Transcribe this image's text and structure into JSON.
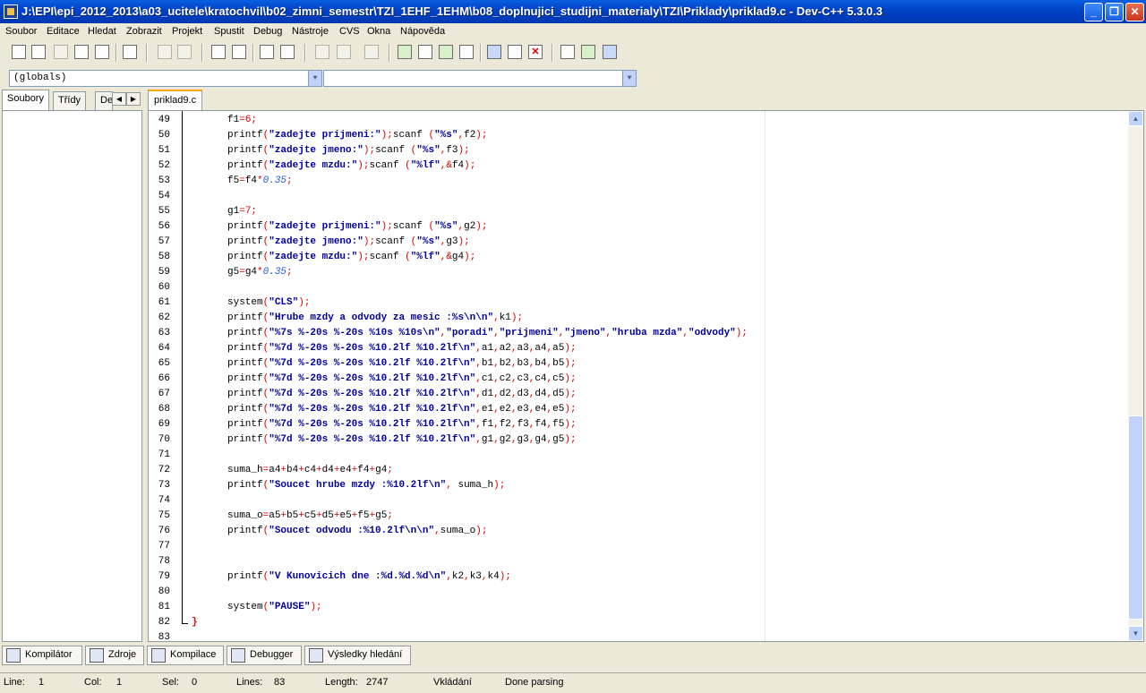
{
  "window": {
    "title": "J:\\EPI\\epi_2012_2013\\a03_ucitele\\kratochvil\\b02_zimni_semestr\\TZI_1EHF_1EHM\\b08_doplnujici_studijni_materialy\\TZI\\Priklady\\priklad9.c - Dev-C++ 5.3.0.3",
    "min": "_",
    "max": "❐",
    "close": "✕"
  },
  "menu": [
    "Soubor",
    "Editace",
    "Hledat",
    "Zobrazit",
    "Projekt",
    "Spustit",
    "Debug",
    "Nástroje",
    "CVS",
    "Okna",
    "Nápověda"
  ],
  "toolbar_icons": [
    "new-file-icon",
    "open-file-icon",
    "save-icon",
    "save-all-icon",
    "close-file-icon",
    "print-icon",
    "undo-icon",
    "redo-icon",
    "find-icon",
    "replace-icon",
    "goto-icon",
    "toggle-bookmark-icon",
    "indent-icon",
    "unindent-icon",
    "comment-icon",
    "compile-icon",
    "run-icon",
    "compile-run-icon",
    "rebuild-icon",
    "syntax-check-icon",
    "chart-icon",
    "stop-icon",
    "class-icon",
    "add-to-project-icon",
    "remove-icon"
  ],
  "combos": {
    "globals": "(globals)",
    "members": ""
  },
  "left_tabs": [
    "Soubory",
    "Třídy",
    "De"
  ],
  "left_arrows": {
    "left": "◀",
    "right": "▶"
  },
  "editor_tab": "priklad9.c",
  "lines": [
    {
      "n": "49",
      "code": [
        [
          "f1"
        ],
        [
          "=",
          "p"
        ],
        [
          "6",
          "p"
        ],
        [
          ";",
          "p"
        ]
      ]
    },
    {
      "n": "50",
      "code": [
        [
          "printf"
        ],
        [
          "(",
          "p"
        ],
        [
          "\"zadejte prijmeni:\"",
          "s"
        ],
        [
          ")",
          "p"
        ],
        [
          ";",
          "p"
        ],
        [
          "scanf "
        ],
        [
          "(",
          "p"
        ],
        [
          "\"%s\"",
          "s"
        ],
        [
          ",",
          "p"
        ],
        [
          "f2"
        ],
        [
          ")",
          "p"
        ],
        [
          ";",
          "p"
        ]
      ]
    },
    {
      "n": "51",
      "code": [
        [
          "printf"
        ],
        [
          "(",
          "p"
        ],
        [
          "\"zadejte jmeno:\"",
          "s"
        ],
        [
          ")",
          "p"
        ],
        [
          ";",
          "p"
        ],
        [
          "scanf "
        ],
        [
          "(",
          "p"
        ],
        [
          "\"%s\"",
          "s"
        ],
        [
          ",",
          "p"
        ],
        [
          "f3"
        ],
        [
          ")",
          "p"
        ],
        [
          ";",
          "p"
        ]
      ]
    },
    {
      "n": "52",
      "code": [
        [
          "printf"
        ],
        [
          "(",
          "p"
        ],
        [
          "\"zadejte mzdu:\"",
          "s"
        ],
        [
          ")",
          "p"
        ],
        [
          ";",
          "p"
        ],
        [
          "scanf "
        ],
        [
          "(",
          "p"
        ],
        [
          "\"%lf\"",
          "s"
        ],
        [
          ",",
          "p"
        ],
        [
          "&",
          "p"
        ],
        [
          "f4"
        ],
        [
          ")",
          "p"
        ],
        [
          ";",
          "p"
        ]
      ]
    },
    {
      "n": "53",
      "code": [
        [
          "f5"
        ],
        [
          "=",
          "p"
        ],
        [
          "f4"
        ],
        [
          "*",
          "p"
        ],
        [
          "0.35",
          "n"
        ],
        [
          ";",
          "p"
        ]
      ]
    },
    {
      "n": "54",
      "code": []
    },
    {
      "n": "55",
      "code": [
        [
          "g1"
        ],
        [
          "=",
          "p"
        ],
        [
          "7",
          "p"
        ],
        [
          ";",
          "p"
        ]
      ]
    },
    {
      "n": "56",
      "code": [
        [
          "printf"
        ],
        [
          "(",
          "p"
        ],
        [
          "\"zadejte prijmeni:\"",
          "s"
        ],
        [
          ")",
          "p"
        ],
        [
          ";",
          "p"
        ],
        [
          "scanf "
        ],
        [
          "(",
          "p"
        ],
        [
          "\"%s\"",
          "s"
        ],
        [
          ",",
          "p"
        ],
        [
          "g2"
        ],
        [
          ")",
          "p"
        ],
        [
          ";",
          "p"
        ]
      ]
    },
    {
      "n": "57",
      "code": [
        [
          "printf"
        ],
        [
          "(",
          "p"
        ],
        [
          "\"zadejte jmeno:\"",
          "s"
        ],
        [
          ")",
          "p"
        ],
        [
          ";",
          "p"
        ],
        [
          "scanf "
        ],
        [
          "(",
          "p"
        ],
        [
          "\"%s\"",
          "s"
        ],
        [
          ",",
          "p"
        ],
        [
          "g3"
        ],
        [
          ")",
          "p"
        ],
        [
          ";",
          "p"
        ]
      ]
    },
    {
      "n": "58",
      "code": [
        [
          "printf"
        ],
        [
          "(",
          "p"
        ],
        [
          "\"zadejte mzdu:\"",
          "s"
        ],
        [
          ")",
          "p"
        ],
        [
          ";",
          "p"
        ],
        [
          "scanf "
        ],
        [
          "(",
          "p"
        ],
        [
          "\"%lf\"",
          "s"
        ],
        [
          ",",
          "p"
        ],
        [
          "&",
          "p"
        ],
        [
          "g4"
        ],
        [
          ")",
          "p"
        ],
        [
          ";",
          "p"
        ]
      ]
    },
    {
      "n": "59",
      "code": [
        [
          "g5"
        ],
        [
          "=",
          "p"
        ],
        [
          "g4"
        ],
        [
          "*",
          "p"
        ],
        [
          "0.35",
          "n"
        ],
        [
          ";",
          "p"
        ]
      ]
    },
    {
      "n": "60",
      "code": []
    },
    {
      "n": "61",
      "code": [
        [
          "system"
        ],
        [
          "(",
          "p"
        ],
        [
          "\"CLS\"",
          "s"
        ],
        [
          ")",
          "p"
        ],
        [
          ";",
          "p"
        ]
      ]
    },
    {
      "n": "62",
      "code": [
        [
          "printf"
        ],
        [
          "(",
          "p"
        ],
        [
          "\"Hrube mzdy a odvody za mesic :%s\\n\\n\"",
          "s"
        ],
        [
          ",",
          "p"
        ],
        [
          "k1"
        ],
        [
          ")",
          "p"
        ],
        [
          ";",
          "p"
        ]
      ]
    },
    {
      "n": "63",
      "code": [
        [
          "printf"
        ],
        [
          "(",
          "p"
        ],
        [
          "\"%7s %-20s %-20s %10s %10s\\n\"",
          "s"
        ],
        [
          ",",
          "p"
        ],
        [
          "\"poradi\"",
          "s"
        ],
        [
          ",",
          "p"
        ],
        [
          "\"prijmeni\"",
          "s"
        ],
        [
          ",",
          "p"
        ],
        [
          "\"jmeno\"",
          "s"
        ],
        [
          ",",
          "p"
        ],
        [
          "\"hruba mzda\"",
          "s"
        ],
        [
          ",",
          "p"
        ],
        [
          "\"odvody\"",
          "s"
        ],
        [
          ")",
          "p"
        ],
        [
          ";",
          "p"
        ]
      ]
    },
    {
      "n": "64",
      "code": [
        [
          "printf"
        ],
        [
          "(",
          "p"
        ],
        [
          "\"%7d %-20s %-20s %10.2lf %10.2lf\\n\"",
          "s"
        ],
        [
          ",",
          "p"
        ],
        [
          "a1"
        ],
        [
          ",",
          "p"
        ],
        [
          "a2"
        ],
        [
          ",",
          "p"
        ],
        [
          "a3"
        ],
        [
          ",",
          "p"
        ],
        [
          "a4"
        ],
        [
          ",",
          "p"
        ],
        [
          "a5"
        ],
        [
          ")",
          "p"
        ],
        [
          ";",
          "p"
        ]
      ]
    },
    {
      "n": "65",
      "code": [
        [
          "printf"
        ],
        [
          "(",
          "p"
        ],
        [
          "\"%7d %-20s %-20s %10.2lf %10.2lf\\n\"",
          "s"
        ],
        [
          ",",
          "p"
        ],
        [
          "b1"
        ],
        [
          ",",
          "p"
        ],
        [
          "b2"
        ],
        [
          ",",
          "p"
        ],
        [
          "b3"
        ],
        [
          ",",
          "p"
        ],
        [
          "b4"
        ],
        [
          ",",
          "p"
        ],
        [
          "b5"
        ],
        [
          ")",
          "p"
        ],
        [
          ";",
          "p"
        ]
      ]
    },
    {
      "n": "66",
      "code": [
        [
          "printf"
        ],
        [
          "(",
          "p"
        ],
        [
          "\"%7d %-20s %-20s %10.2lf %10.2lf\\n\"",
          "s"
        ],
        [
          ",",
          "p"
        ],
        [
          "c1"
        ],
        [
          ",",
          "p"
        ],
        [
          "c2"
        ],
        [
          ",",
          "p"
        ],
        [
          "c3"
        ],
        [
          ",",
          "p"
        ],
        [
          "c4"
        ],
        [
          ",",
          "p"
        ],
        [
          "c5"
        ],
        [
          ")",
          "p"
        ],
        [
          ";",
          "p"
        ]
      ]
    },
    {
      "n": "67",
      "code": [
        [
          "printf"
        ],
        [
          "(",
          "p"
        ],
        [
          "\"%7d %-20s %-20s %10.2lf %10.2lf\\n\"",
          "s"
        ],
        [
          ",",
          "p"
        ],
        [
          "d1"
        ],
        [
          ",",
          "p"
        ],
        [
          "d2"
        ],
        [
          ",",
          "p"
        ],
        [
          "d3"
        ],
        [
          ",",
          "p"
        ],
        [
          "d4"
        ],
        [
          ",",
          "p"
        ],
        [
          "d5"
        ],
        [
          ")",
          "p"
        ],
        [
          ";",
          "p"
        ]
      ]
    },
    {
      "n": "68",
      "code": [
        [
          "printf"
        ],
        [
          "(",
          "p"
        ],
        [
          "\"%7d %-20s %-20s %10.2lf %10.2lf\\n\"",
          "s"
        ],
        [
          ",",
          "p"
        ],
        [
          "e1"
        ],
        [
          ",",
          "p"
        ],
        [
          "e2"
        ],
        [
          ",",
          "p"
        ],
        [
          "e3"
        ],
        [
          ",",
          "p"
        ],
        [
          "e4"
        ],
        [
          ",",
          "p"
        ],
        [
          "e5"
        ],
        [
          ")",
          "p"
        ],
        [
          ";",
          "p"
        ]
      ]
    },
    {
      "n": "69",
      "code": [
        [
          "printf"
        ],
        [
          "(",
          "p"
        ],
        [
          "\"%7d %-20s %-20s %10.2lf %10.2lf\\n\"",
          "s"
        ],
        [
          ",",
          "p"
        ],
        [
          "f1"
        ],
        [
          ",",
          "p"
        ],
        [
          "f2"
        ],
        [
          ",",
          "p"
        ],
        [
          "f3"
        ],
        [
          ",",
          "p"
        ],
        [
          "f4"
        ],
        [
          ",",
          "p"
        ],
        [
          "f5"
        ],
        [
          ")",
          "p"
        ],
        [
          ";",
          "p"
        ]
      ]
    },
    {
      "n": "70",
      "code": [
        [
          "printf"
        ],
        [
          "(",
          "p"
        ],
        [
          "\"%7d %-20s %-20s %10.2lf %10.2lf\\n\"",
          "s"
        ],
        [
          ",",
          "p"
        ],
        [
          "g1"
        ],
        [
          ",",
          "p"
        ],
        [
          "g2"
        ],
        [
          ",",
          "p"
        ],
        [
          "g3"
        ],
        [
          ",",
          "p"
        ],
        [
          "g4"
        ],
        [
          ",",
          "p"
        ],
        [
          "g5"
        ],
        [
          ")",
          "p"
        ],
        [
          ";",
          "p"
        ]
      ]
    },
    {
      "n": "71",
      "code": []
    },
    {
      "n": "72",
      "code": [
        [
          "suma_h"
        ],
        [
          "=",
          "p"
        ],
        [
          "a4"
        ],
        [
          "+",
          "p"
        ],
        [
          "b4"
        ],
        [
          "+",
          "p"
        ],
        [
          "c4"
        ],
        [
          "+",
          "p"
        ],
        [
          "d4"
        ],
        [
          "+",
          "p"
        ],
        [
          "e4"
        ],
        [
          "+",
          "p"
        ],
        [
          "f4"
        ],
        [
          "+",
          "p"
        ],
        [
          "g4"
        ],
        [
          ";",
          "p"
        ]
      ]
    },
    {
      "n": "73",
      "code": [
        [
          "printf"
        ],
        [
          "(",
          "p"
        ],
        [
          "\"Soucet hrube mzdy :%10.2lf\\n\"",
          "s"
        ],
        [
          ",",
          "p"
        ],
        [
          " suma_h"
        ],
        [
          ")",
          "p"
        ],
        [
          ";",
          "p"
        ]
      ]
    },
    {
      "n": "74",
      "code": []
    },
    {
      "n": "75",
      "code": [
        [
          "suma_o"
        ],
        [
          "=",
          "p"
        ],
        [
          "a5"
        ],
        [
          "+",
          "p"
        ],
        [
          "b5"
        ],
        [
          "+",
          "p"
        ],
        [
          "c5"
        ],
        [
          "+",
          "p"
        ],
        [
          "d5"
        ],
        [
          "+",
          "p"
        ],
        [
          "e5"
        ],
        [
          "+",
          "p"
        ],
        [
          "f5"
        ],
        [
          "+",
          "p"
        ],
        [
          "g5"
        ],
        [
          ";",
          "p"
        ]
      ]
    },
    {
      "n": "76",
      "code": [
        [
          "printf"
        ],
        [
          "(",
          "p"
        ],
        [
          "\"Soucet odvodu :%10.2lf\\n\\n\"",
          "s"
        ],
        [
          ",",
          "p"
        ],
        [
          "suma_o"
        ],
        [
          ")",
          "p"
        ],
        [
          ";",
          "p"
        ]
      ]
    },
    {
      "n": "77",
      "code": []
    },
    {
      "n": "78",
      "code": []
    },
    {
      "n": "79",
      "code": [
        [
          "printf"
        ],
        [
          "(",
          "p"
        ],
        [
          "\"V Kunovicich dne :%d.%d.%d\\n\"",
          "s"
        ],
        [
          ",",
          "p"
        ],
        [
          "k2"
        ],
        [
          ",",
          "p"
        ],
        [
          "k3"
        ],
        [
          ",",
          "p"
        ],
        [
          "k4"
        ],
        [
          ")",
          "p"
        ],
        [
          ";",
          "p"
        ]
      ]
    },
    {
      "n": "80",
      "code": []
    },
    {
      "n": "81",
      "code": [
        [
          "system"
        ],
        [
          "(",
          "p"
        ],
        [
          "\"PAUSE\"",
          "s"
        ],
        [
          ")",
          "p"
        ],
        [
          ";",
          "p"
        ]
      ]
    },
    {
      "n": "82",
      "code": [
        [
          "}",
          "b"
        ]
      ],
      "indent": false
    },
    {
      "n": "83",
      "code": [],
      "indent": false
    }
  ],
  "scroll": {
    "up": "▲",
    "down": "▼"
  },
  "bottom_tabs": [
    {
      "label": "Kompilátor",
      "icon": "compiler-grid-icon"
    },
    {
      "label": "Zdroje",
      "icon": "resources-icon"
    },
    {
      "label": "Kompilace",
      "icon": "compile-log-chart-icon"
    },
    {
      "label": "Debugger",
      "icon": "debugger-check-icon"
    },
    {
      "label": "Výsledky hledání",
      "icon": "search-results-icon"
    }
  ],
  "status": {
    "line_label": "Line:",
    "line": "1",
    "col_label": "Col:",
    "col": "1",
    "sel_label": "Sel:",
    "sel": "0",
    "lines_label": "Lines:",
    "lines": "83",
    "length_label": "Length:",
    "length": "2747",
    "mode": "Vkládání",
    "parse": "Done parsing"
  }
}
